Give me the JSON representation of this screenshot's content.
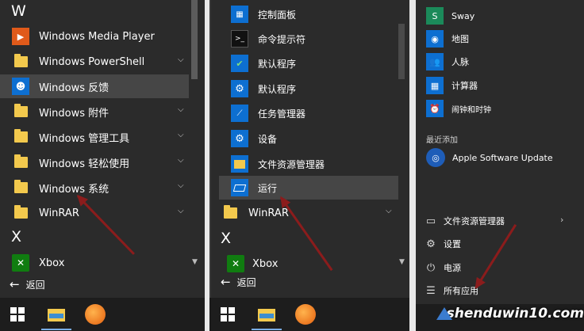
{
  "panel1": {
    "section_w": "W",
    "items": [
      {
        "label": "Windows Media Player",
        "icon": "media-player-icon"
      },
      {
        "label": "Windows PowerShell",
        "icon": "folder-icon"
      },
      {
        "label": "Windows 反馈",
        "icon": "feedback-icon"
      },
      {
        "label": "Windows 附件",
        "icon": "folder-icon"
      },
      {
        "label": "Windows 管理工具",
        "icon": "folder-icon"
      },
      {
        "label": "Windows 轻松使用",
        "icon": "folder-icon"
      },
      {
        "label": "Windows 系统",
        "icon": "folder-icon"
      },
      {
        "label": "WinRAR",
        "icon": "folder-icon"
      }
    ],
    "section_x": "X",
    "xbox": "Xbox",
    "back": "返回"
  },
  "panel2": {
    "items": [
      {
        "label": "控制面板",
        "icon": "control-panel-icon"
      },
      {
        "label": "命令提示符",
        "icon": "command-prompt-icon"
      },
      {
        "label": "默认程序",
        "icon": "default-programs-icon"
      },
      {
        "label": "默认程序",
        "icon": "gear-icon"
      },
      {
        "label": "任务管理器",
        "icon": "task-manager-icon"
      },
      {
        "label": "设备",
        "icon": "gear-icon"
      },
      {
        "label": "文件资源管理器",
        "icon": "folder-icon"
      },
      {
        "label": "运行",
        "icon": "run-icon"
      }
    ],
    "winrar": "WinRAR",
    "section_x": "X",
    "xbox": "Xbox",
    "back": "返回"
  },
  "panel3": {
    "apps": [
      {
        "label": "Sway",
        "icon": "sway-icon"
      },
      {
        "label": "地图",
        "icon": "maps-icon"
      },
      {
        "label": "人脉",
        "icon": "people-icon"
      },
      {
        "label": "计算器",
        "icon": "calculator-icon"
      },
      {
        "label": "闹钟和时钟",
        "icon": "alarm-icon"
      }
    ],
    "recent_header": "最近添加",
    "recent_app": "Apple Software Update",
    "nav": [
      {
        "label": "文件资源管理器",
        "icon": "file-explorer-icon"
      },
      {
        "label": "设置",
        "icon": "gear-icon"
      },
      {
        "label": "电源",
        "icon": "power-icon"
      },
      {
        "label": "所有应用",
        "icon": "list-icon"
      }
    ]
  },
  "watermark": "shenduwin10.com",
  "colors": {
    "background": "#2b2b2b",
    "accent": "#0d6fd1",
    "highlight": "#464646",
    "folder": "#f3c94d",
    "arrow": "#8b1c1c",
    "xbox": "#107c10"
  }
}
